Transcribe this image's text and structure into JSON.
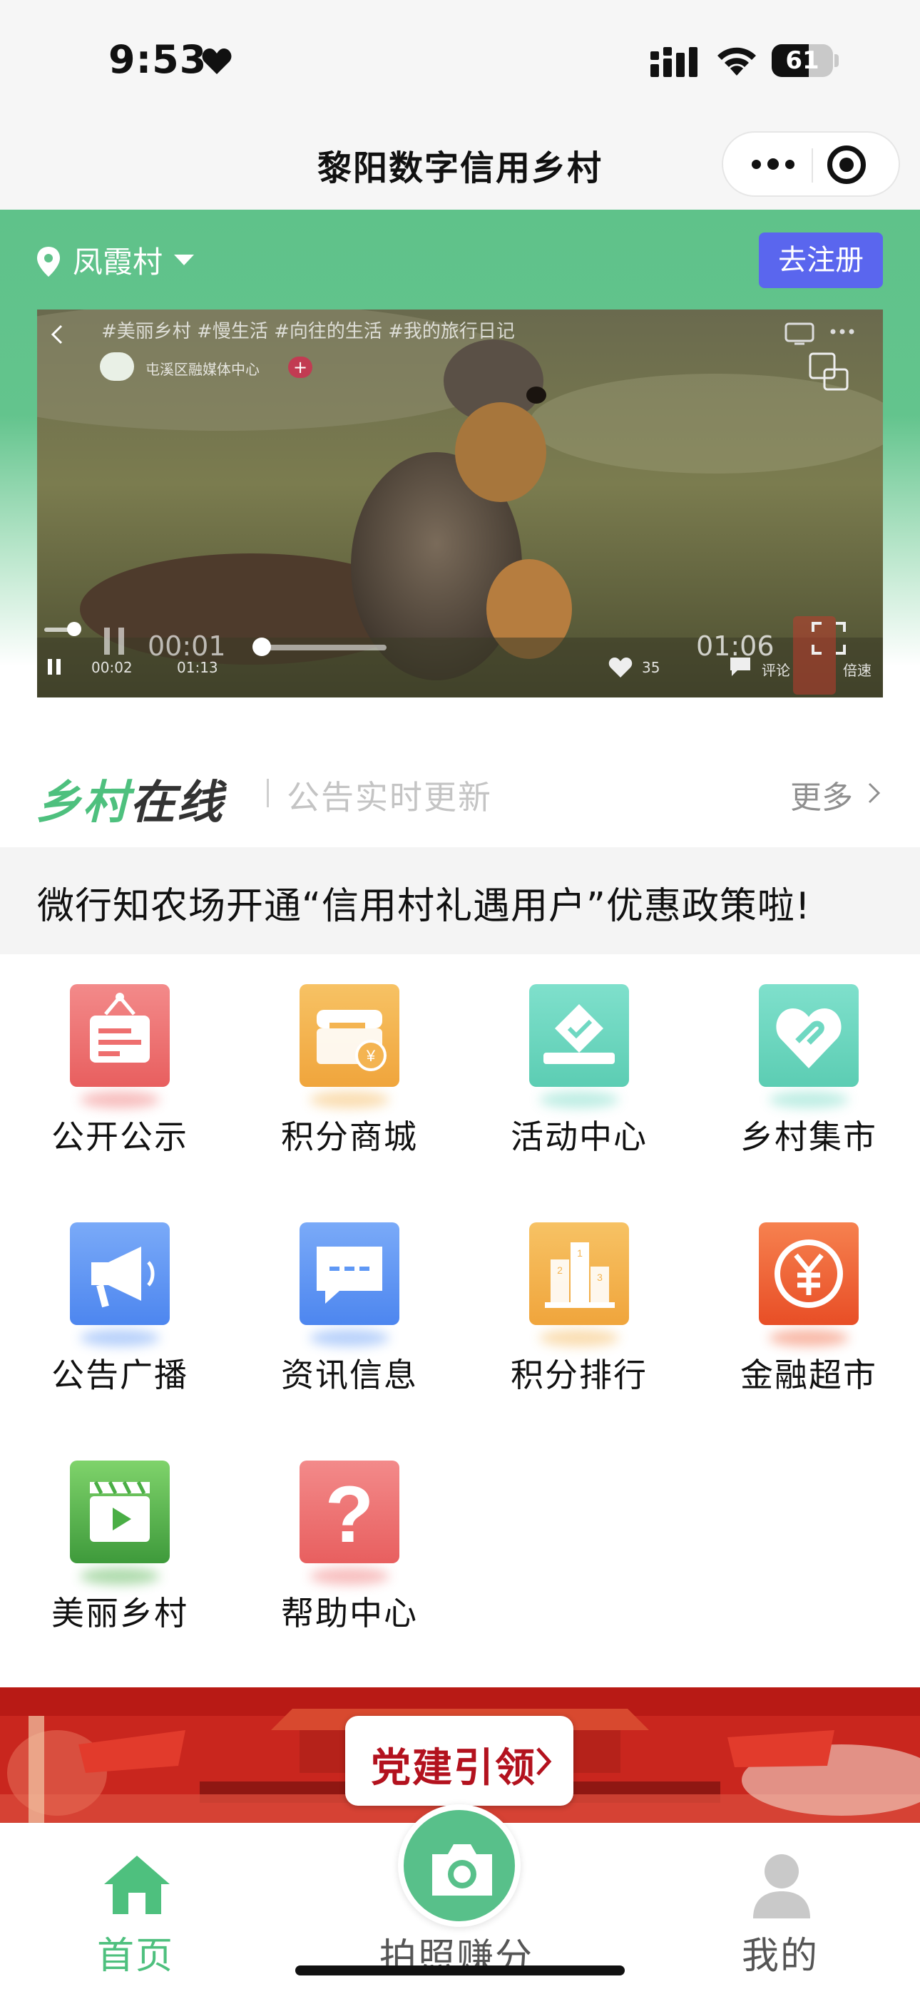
{
  "status_bar": {
    "time": "9:53",
    "battery": "61",
    "battery_level": 0.61
  },
  "nav": {
    "title": "黎阳数字信用乡村"
  },
  "header": {
    "village": "凤霞村",
    "register_label": "去注册"
  },
  "video": {
    "hashtags": "#美丽乡村 #慢生活 #向往的生活 #我的旅行日记",
    "channel": "屯溪区融媒体中心",
    "plus": "+",
    "current_time": "00:01",
    "duration": "01:06",
    "small_time_a": "00:02",
    "small_time_b": "01:13",
    "likes": "35",
    "comment_label": "评论",
    "speed_label": "倍速"
  },
  "announcement": {
    "logo_part1": "乡村",
    "logo_part2": "在线",
    "subtitle": "公告实时更新",
    "more_label": "更多",
    "text": "微行知农场开通“信用村礼遇用户”优惠政策啦!"
  },
  "grid": {
    "items": [
      {
        "label": "公开公示",
        "icon": "notice-board-icon",
        "color": "#ee6f6f"
      },
      {
        "label": "积分商城",
        "icon": "shop-icon",
        "color": "#f4b451"
      },
      {
        "label": "活动中心",
        "icon": "ballot-box-icon",
        "color": "#6fd8c2"
      },
      {
        "label": "乡村集市",
        "icon": "heart-hands-icon",
        "color": "#6fd8c2"
      },
      {
        "label": "公告广播",
        "icon": "megaphone-icon",
        "color": "#5f98f5"
      },
      {
        "label": "资讯信息",
        "icon": "chat-bubble-icon",
        "color": "#5f98f5"
      },
      {
        "label": "积分排行",
        "icon": "podium-icon",
        "color": "#f4b451"
      },
      {
        "label": "金融超市",
        "icon": "yen-coin-icon",
        "color": "#f0623a"
      },
      {
        "label": "美丽乡村",
        "icon": "video-clapper-icon",
        "color": "#4aae45"
      },
      {
        "label": "帮助中心",
        "icon": "question-icon",
        "color": "#ee6f6f"
      }
    ]
  },
  "party": {
    "label": "党建引领"
  },
  "tabs": {
    "home": "首页",
    "photo": "拍照赚分",
    "me": "我的"
  },
  "colors": {
    "brand_green": "#4ec07e",
    "register_blue": "#5a66ee",
    "party_red": "#c9261e"
  }
}
